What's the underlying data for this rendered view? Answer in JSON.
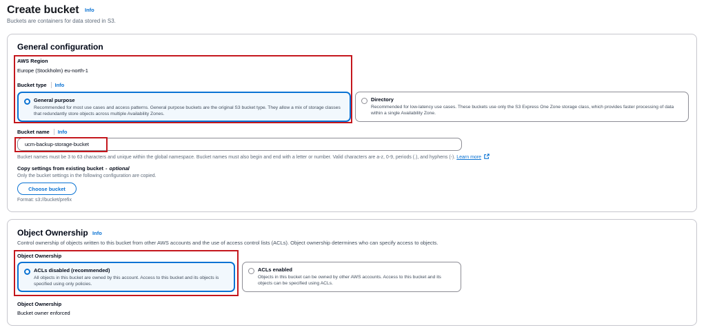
{
  "header": {
    "title": "Create bucket",
    "info": "Info",
    "subtitle": "Buckets are containers for data stored in S3."
  },
  "general": {
    "heading": "General configuration",
    "region_label": "AWS Region",
    "region_value": "Europe (Stockholm) eu-north-1",
    "bucket_type_label": "Bucket type",
    "bucket_type_info": "Info",
    "types": [
      {
        "title": "General purpose",
        "desc": "Recommended for most use cases and access patterns. General purpose buckets are the original S3 bucket type. They allow a mix of storage classes that redundantly store objects across multiple Availability Zones.",
        "selected": true
      },
      {
        "title": "Directory",
        "desc": "Recommended for low-latency use cases. These buckets use only the S3 Express One Zone storage class, which provides faster processing of data within a single Availability Zone.",
        "selected": false
      }
    ],
    "bucket_name_label": "Bucket name",
    "bucket_name_info": "Info",
    "bucket_name_value": "ucm-backup-storage-bucket",
    "bucket_name_hint": "Bucket names must be 3 to 63 characters and unique within the global namespace. Bucket names must also begin and end with a letter or number. Valid characters are a-z, 0-9, periods (.), and hyphens (-).",
    "learn_more": "Learn more",
    "copy_label": "Copy settings from existing bucket",
    "copy_optional": "optional",
    "copy_hint": "Only the bucket settings in the following configuration are copied.",
    "choose_bucket_button": "Choose bucket",
    "format_hint": "Format: s3://bucket/prefix"
  },
  "ownership": {
    "heading": "Object Ownership",
    "info": "Info",
    "desc": "Control ownership of objects written to this bucket from other AWS accounts and the use of access control lists (ACLs). Object ownership determines who can specify access to objects.",
    "group_label": "Object Ownership",
    "options": [
      {
        "title": "ACLs disabled (recommended)",
        "desc": "All objects in this bucket are owned by this account. Access to this bucket and its objects is specified using only policies.",
        "selected": true
      },
      {
        "title": "ACLs enabled",
        "desc": "Objects in this bucket can be owned by other AWS accounts. Access to this bucket and its objects can be specified using ACLs.",
        "selected": false
      }
    ],
    "summary_label": "Object Ownership",
    "summary_value": "Bucket owner enforced"
  },
  "colors": {
    "accent": "#0972d3",
    "highlight": "#c4161c",
    "border": "#c6c6cd"
  },
  "icons": {
    "external_link": "external-link-icon"
  }
}
